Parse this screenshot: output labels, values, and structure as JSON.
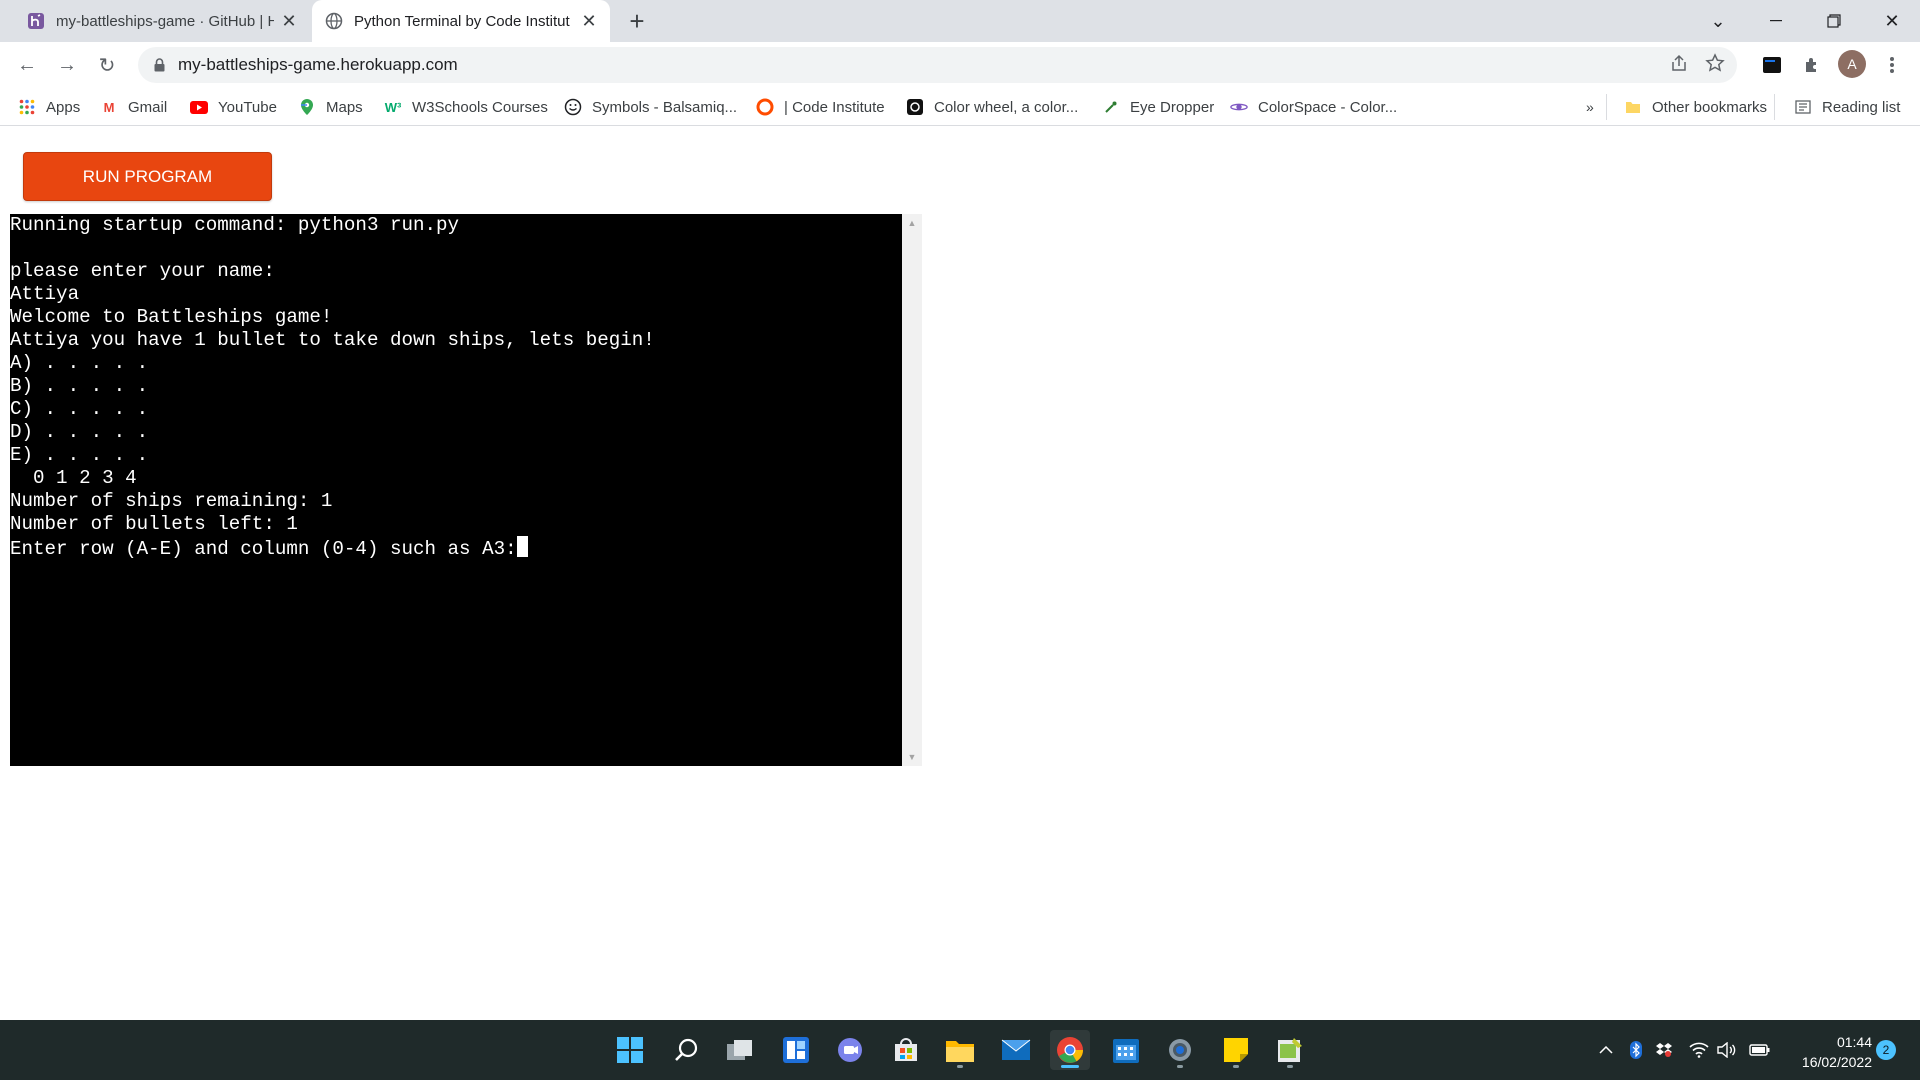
{
  "tabs": [
    {
      "title": "my-battleships-game · GitHub | H",
      "favicon": "heroku-icon",
      "active": false
    },
    {
      "title": "Python Terminal by Code Institut",
      "favicon": "globe-icon",
      "active": true
    }
  ],
  "toolbar": {
    "url": "my-battleships-game.herokuapp.com",
    "avatar_letter": "A"
  },
  "bookmarks": [
    {
      "label": "Apps",
      "icon": "apps-grid-icon"
    },
    {
      "label": "Gmail",
      "icon": "gmail-icon"
    },
    {
      "label": "YouTube",
      "icon": "youtube-icon"
    },
    {
      "label": "Maps",
      "icon": "maps-icon"
    },
    {
      "label": "W3Schools Courses",
      "icon": "w3schools-icon"
    },
    {
      "label": "Symbols - Balsamiq...",
      "icon": "smiley-icon"
    },
    {
      "label": "| Code Institute",
      "icon": "code-institute-icon"
    },
    {
      "label": "Color wheel, a color...",
      "icon": "color-wheel-icon"
    },
    {
      "label": "Eye Dropper",
      "icon": "eye-dropper-icon"
    },
    {
      "label": "ColorSpace - Color...",
      "icon": "colorspace-icon"
    }
  ],
  "bookmarks_overflow": "»",
  "other_bookmarks": "Other bookmarks",
  "reading_list": "Reading list",
  "page": {
    "run_button": "RUN PROGRAM",
    "terminal_lines": [
      "Running startup command: python3 run.py",
      "",
      "please enter your name:",
      "Attiya",
      "Welcome to Battleships game!",
      "Attiya you have 1 bullet to take down ships, lets begin!",
      "A) . . . . .",
      "B) . . . . .",
      "C) . . . . .",
      "D) . . . . .",
      "E) . . . . .",
      "  0 1 2 3 4",
      "Number of ships remaining: 1",
      "Number of bullets left: 1"
    ],
    "prompt_line": "Enter row (A-E) and column (0-4) such as A3:"
  },
  "taskbar": {
    "apps": [
      "start-icon",
      "search-icon",
      "task-view-icon",
      "widgets-icon",
      "teams-chat-icon",
      "microsoft-store-icon",
      "file-explorer-icon",
      "mail-icon",
      "chrome-icon",
      "calendar-icon",
      "settings-icon",
      "sticky-notes-icon",
      "game-icon"
    ],
    "time": "01:44",
    "date": "16/02/2022",
    "notifications": "2"
  },
  "colors": {
    "run_button": "#e84610",
    "terminal_bg": "#000000",
    "taskbar_bg": "#1f2a2a"
  }
}
